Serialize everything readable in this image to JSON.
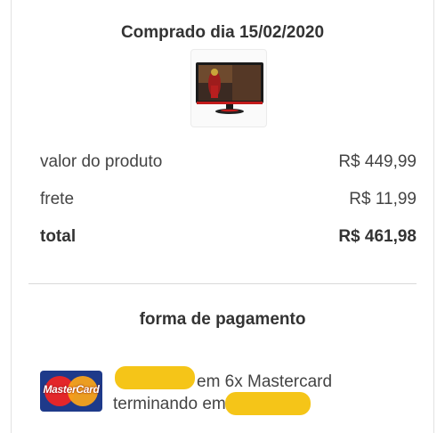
{
  "order": {
    "purchase_date_label": "Comprado dia 15/02/2020"
  },
  "product": {
    "image_icon": "monitor-icon"
  },
  "summary": {
    "rows": [
      {
        "label": "valor do produto",
        "value": "R$ 449,99"
      },
      {
        "label": "frete",
        "value": "R$ 11,99"
      },
      {
        "label": "total",
        "value": "R$ 461,98"
      }
    ]
  },
  "payment": {
    "title": "forma de pagamento",
    "card_brand": "MasterCard",
    "installments_text": "em 6x Mastercard",
    "ending_text": "terminando em"
  },
  "colors": {
    "redaction": "#f5c518",
    "card_blue": "#1e3a8a",
    "mc_red": "#e3262a",
    "mc_orange": "#f7a21b"
  }
}
